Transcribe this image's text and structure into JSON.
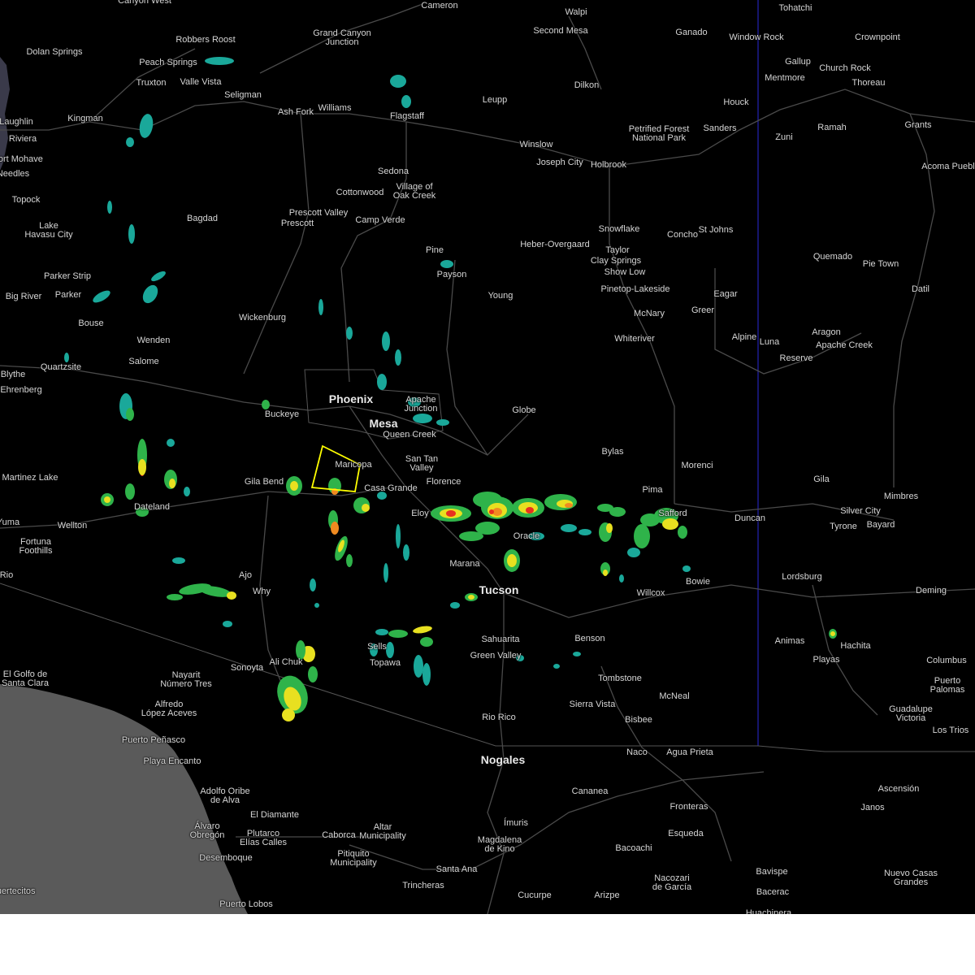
{
  "map": {
    "colors": {
      "background": "#000000",
      "ocean": "#5a5a5a",
      "roads": "#4a4a4a",
      "state_border": "#2a2ad8",
      "warning_polygon": "#ffff00",
      "radar_light": "#1aa89a",
      "radar_green": "#2fb34a",
      "radar_yellow": "#e8e020",
      "radar_orange": "#f08a20",
      "radar_red": "#e83020"
    },
    "places": [
      {
        "id": "canyon-west",
        "label": "Canyon West"
      },
      {
        "id": "cameron",
        "label": "Cameron"
      },
      {
        "id": "walpi",
        "label": "Walpi"
      },
      {
        "id": "tohatchi",
        "label": "Tohatchi"
      },
      {
        "id": "robbers-roost",
        "label": "Robbers Roost"
      },
      {
        "id": "grand-canyon-junction",
        "label": "Grand Canyon\nJunction"
      },
      {
        "id": "second-mesa",
        "label": "Second Mesa"
      },
      {
        "id": "ganado",
        "label": "Ganado"
      },
      {
        "id": "window-rock",
        "label": "Window Rock"
      },
      {
        "id": "crownpoint",
        "label": "Crownpoint"
      },
      {
        "id": "dolan-springs",
        "label": "Dolan Springs"
      },
      {
        "id": "peach-springs",
        "label": "Peach Springs"
      },
      {
        "id": "truxton",
        "label": "Truxton"
      },
      {
        "id": "valle-vista",
        "label": "Valle Vista"
      },
      {
        "id": "gallup",
        "label": "Gallup"
      },
      {
        "id": "mentmore",
        "label": "Mentmore"
      },
      {
        "id": "church-rock",
        "label": "Church Rock"
      },
      {
        "id": "thoreau",
        "label": "Thoreau"
      },
      {
        "id": "dilkon",
        "label": "Dilkon"
      },
      {
        "id": "seligman",
        "label": "Seligman"
      },
      {
        "id": "ash-fork",
        "label": "Ash Fork"
      },
      {
        "id": "williams",
        "label": "Williams"
      },
      {
        "id": "flagstaff",
        "label": "Flagstaff"
      },
      {
        "id": "leupp",
        "label": "Leupp"
      },
      {
        "id": "houck",
        "label": "Houck"
      },
      {
        "id": "sanders",
        "label": "Sanders"
      },
      {
        "id": "laughlin",
        "label": "Laughlin"
      },
      {
        "id": "kingman",
        "label": "Kingman"
      },
      {
        "id": "petrified-forest",
        "label": "Petrified Forest\nNational Park"
      },
      {
        "id": "ramah",
        "label": "Ramah"
      },
      {
        "id": "grants",
        "label": "Grants"
      },
      {
        "id": "riviera",
        "label": "Riviera"
      },
      {
        "id": "zuni",
        "label": "Zuni"
      },
      {
        "id": "fort-mohave",
        "label": "Fort Mohave"
      },
      {
        "id": "winslow",
        "label": "Winslow"
      },
      {
        "id": "needles",
        "label": "Needles"
      },
      {
        "id": "joseph-city",
        "label": "Joseph City"
      },
      {
        "id": "holbrook",
        "label": "Holbrook"
      },
      {
        "id": "acoma-pueblo",
        "label": "Acoma Pueblo"
      },
      {
        "id": "sedona",
        "label": "Sedona"
      },
      {
        "id": "village-of-oak-creek",
        "label": "Village of\nOak Creek"
      },
      {
        "id": "topock",
        "label": "Topock"
      },
      {
        "id": "cottonwood",
        "label": "Cottonwood"
      },
      {
        "id": "prescott-valley",
        "label": "Prescott Valley"
      },
      {
        "id": "bagdad",
        "label": "Bagdad"
      },
      {
        "id": "prescott",
        "label": "Prescott"
      },
      {
        "id": "camp-verde",
        "label": "Camp Verde"
      },
      {
        "id": "snowflake",
        "label": "Snowflake"
      },
      {
        "id": "lake-havasu-city",
        "label": "Lake\nHavasu City"
      },
      {
        "id": "concho",
        "label": "Concho"
      },
      {
        "id": "st-johns",
        "label": "St Johns"
      },
      {
        "id": "heber-overgaard",
        "label": "Heber-Overgaard"
      },
      {
        "id": "taylor",
        "label": "Taylor"
      },
      {
        "id": "pine",
        "label": "Pine"
      },
      {
        "id": "clay-springs",
        "label": "Clay Springs"
      },
      {
        "id": "quemado",
        "label": "Quemado"
      },
      {
        "id": "show-low",
        "label": "Show Low"
      },
      {
        "id": "pie-town",
        "label": "Pie Town"
      },
      {
        "id": "parker-strip",
        "label": "Parker Strip"
      },
      {
        "id": "payson",
        "label": "Payson"
      },
      {
        "id": "pinetop-lakeside",
        "label": "Pinetop-Lakeside"
      },
      {
        "id": "datil",
        "label": "Datil"
      },
      {
        "id": "big-river",
        "label": "Big River"
      },
      {
        "id": "parker",
        "label": "Parker"
      },
      {
        "id": "young",
        "label": "Young"
      },
      {
        "id": "eagar",
        "label": "Eagar"
      },
      {
        "id": "mcnary",
        "label": "McNary"
      },
      {
        "id": "greer",
        "label": "Greer"
      },
      {
        "id": "wickenburg",
        "label": "Wickenburg"
      },
      {
        "id": "bouse",
        "label": "Bouse"
      },
      {
        "id": "aragon",
        "label": "Aragon"
      },
      {
        "id": "alpine",
        "label": "Alpine"
      },
      {
        "id": "luna",
        "label": "Luna"
      },
      {
        "id": "wenden",
        "label": "Wenden"
      },
      {
        "id": "whiteriver",
        "label": "Whiteriver"
      },
      {
        "id": "apache-creek",
        "label": "Apache Creek"
      },
      {
        "id": "reserve",
        "label": "Reserve"
      },
      {
        "id": "salome",
        "label": "Salome"
      },
      {
        "id": "quartzsite",
        "label": "Quartzsite"
      },
      {
        "id": "blythe",
        "label": "Blythe"
      },
      {
        "id": "ehrenberg",
        "label": "Ehrenberg"
      },
      {
        "id": "phoenix",
        "label": "Phoenix"
      },
      {
        "id": "apache-junction",
        "label": "Apache\nJunction"
      },
      {
        "id": "buckeye",
        "label": "Buckeye"
      },
      {
        "id": "mesa",
        "label": "Mesa"
      },
      {
        "id": "globe",
        "label": "Globe"
      },
      {
        "id": "queen-creek",
        "label": "Queen Creek"
      },
      {
        "id": "bylas",
        "label": "Bylas"
      },
      {
        "id": "san-tan-valley",
        "label": "San Tan\nValley"
      },
      {
        "id": "maricopa",
        "label": "Maricopa"
      },
      {
        "id": "morenci",
        "label": "Morenci"
      },
      {
        "id": "martinez-lake",
        "label": "Martinez Lake"
      },
      {
        "id": "gila-bend",
        "label": "Gila Bend"
      },
      {
        "id": "florence",
        "label": "Florence"
      },
      {
        "id": "gila",
        "label": "Gila"
      },
      {
        "id": "casa-grande",
        "label": "Casa Grande"
      },
      {
        "id": "pima",
        "label": "Pima"
      },
      {
        "id": "mimbres",
        "label": "Mimbres"
      },
      {
        "id": "dateland",
        "label": "Dateland"
      },
      {
        "id": "silver-city",
        "label": "Silver City"
      },
      {
        "id": "eloy",
        "label": "Eloy"
      },
      {
        "id": "safford",
        "label": "Safford"
      },
      {
        "id": "duncan",
        "label": "Duncan"
      },
      {
        "id": "yuma",
        "label": "Yuma"
      },
      {
        "id": "wellton",
        "label": "Wellton"
      },
      {
        "id": "tyrone",
        "label": "Tyrone"
      },
      {
        "id": "bayard",
        "label": "Bayard"
      },
      {
        "id": "oracle",
        "label": "Oracle"
      },
      {
        "id": "fortuna-foothills",
        "label": "Fortuna\nFoothills"
      },
      {
        "id": "marana",
        "label": "Marana"
      },
      {
        "id": "rio",
        "label": "Rio"
      },
      {
        "id": "ajo",
        "label": "Ajo"
      },
      {
        "id": "lordsburg",
        "label": "Lordsburg"
      },
      {
        "id": "bowie",
        "label": "Bowie"
      },
      {
        "id": "why",
        "label": "Why"
      },
      {
        "id": "tucson",
        "label": "Tucson"
      },
      {
        "id": "willcox",
        "label": "Willcox"
      },
      {
        "id": "deming",
        "label": "Deming"
      },
      {
        "id": "sells",
        "label": "Sells"
      },
      {
        "id": "benson",
        "label": "Benson"
      },
      {
        "id": "sahuarita",
        "label": "Sahuarita"
      },
      {
        "id": "animas",
        "label": "Animas"
      },
      {
        "id": "hachita",
        "label": "Hachita"
      },
      {
        "id": "green-valley",
        "label": "Green Valley"
      },
      {
        "id": "ali-chuk",
        "label": "Ali Chuk"
      },
      {
        "id": "playas",
        "label": "Playas"
      },
      {
        "id": "topawa",
        "label": "Topawa"
      },
      {
        "id": "columbus",
        "label": "Columbus"
      },
      {
        "id": "sonoyta",
        "label": "Sonoyta"
      },
      {
        "id": "el-golfo",
        "label": "El Golfo de\nSanta Clara"
      },
      {
        "id": "tombstone",
        "label": "Tombstone"
      },
      {
        "id": "nayarit",
        "label": "Nayarit\nNúmero Tres"
      },
      {
        "id": "puerto-palomas",
        "label": "Puerto\nPalomas"
      },
      {
        "id": "mcneal",
        "label": "McNeal"
      },
      {
        "id": "sierra-vista",
        "label": "Sierra Vista"
      },
      {
        "id": "alfredo-lopez",
        "label": "Alfredo\nLópez Aceves"
      },
      {
        "id": "guadalupe-victoria",
        "label": "Guadalupe\nVictoria"
      },
      {
        "id": "rio-rico",
        "label": "Rio Rico"
      },
      {
        "id": "bisbee",
        "label": "Bisbee"
      },
      {
        "id": "los-trios",
        "label": "Los Trios"
      },
      {
        "id": "puerto-penasco",
        "label": "Puerto Peñasco"
      },
      {
        "id": "naco",
        "label": "Naco"
      },
      {
        "id": "agua-prieta",
        "label": "Agua Prieta"
      },
      {
        "id": "playa-encanto",
        "label": "Playa Encanto"
      },
      {
        "id": "nogales",
        "label": "Nogales"
      },
      {
        "id": "cananea",
        "label": "Cananea"
      },
      {
        "id": "ascension",
        "label": "Ascensión"
      },
      {
        "id": "adolfo-oribe",
        "label": "Adolfo Oribe\nde Alva"
      },
      {
        "id": "fronteras",
        "label": "Fronteras"
      },
      {
        "id": "janos",
        "label": "Janos"
      },
      {
        "id": "el-diamante",
        "label": "El Diamante"
      },
      {
        "id": "imuris",
        "label": "Ímuris"
      },
      {
        "id": "alvaro-obregon",
        "label": "Álvaro\nObregón"
      },
      {
        "id": "plutarco",
        "label": "Plutarco\nElías Calles"
      },
      {
        "id": "caborca",
        "label": "Caborca"
      },
      {
        "id": "altar",
        "label": "Altar\nMunicipality"
      },
      {
        "id": "esqueda",
        "label": "Esqueda"
      },
      {
        "id": "magdalena",
        "label": "Magdalena\nde Kino"
      },
      {
        "id": "bacoachi",
        "label": "Bacoachi"
      },
      {
        "id": "desemboque",
        "label": "Desemboque"
      },
      {
        "id": "pitiquito",
        "label": "Pitiquito\nMunicipality"
      },
      {
        "id": "santa-ana",
        "label": "Santa Ana"
      },
      {
        "id": "nacozari",
        "label": "Nacozari\nde García"
      },
      {
        "id": "bavispe",
        "label": "Bavispe"
      },
      {
        "id": "nuevo-casas-grandes",
        "label": "Nuevo Casas\nGrandes"
      },
      {
        "id": "trincheras",
        "label": "Trincheras"
      },
      {
        "id": "bacerac",
        "label": "Bacerac"
      },
      {
        "id": "cucurpe",
        "label": "Cucurpe"
      },
      {
        "id": "arizpe",
        "label": "Arizpe"
      },
      {
        "id": "puerto-lobos",
        "label": "Puerto Lobos"
      },
      {
        "id": "puertecitos",
        "label": "Puertecitos"
      },
      {
        "id": "huachinera",
        "label": "Huachinera"
      }
    ]
  }
}
